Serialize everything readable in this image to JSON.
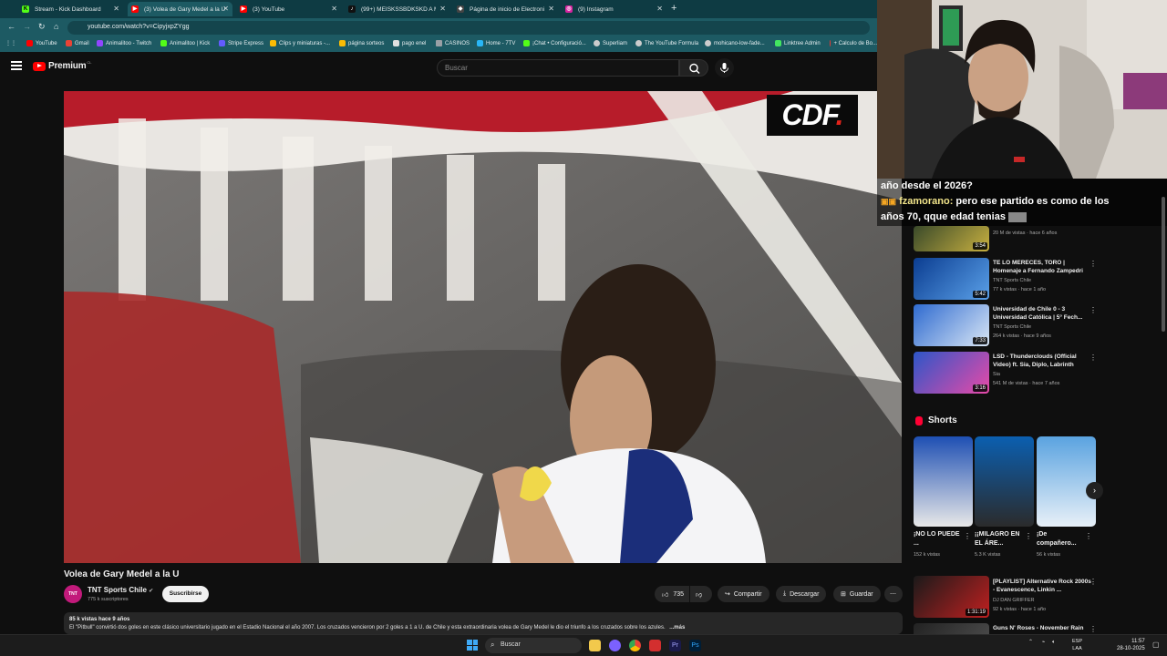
{
  "browser": {
    "tabs": [
      {
        "label": "Stream - Kick Dashboard",
        "icon": "kick-icon",
        "color": "#53fc18"
      },
      {
        "label": "(3) Volea de Gary Medel a la U",
        "icon": "youtube-icon",
        "color": "#ff0000"
      },
      {
        "label": "(3) YouTube",
        "icon": "youtube-icon",
        "color": "#ff0000"
      },
      {
        "label": "(99+) MEISKSSBDKSKD A MAMÁ",
        "icon": "tiktok-icon",
        "color": "#111111"
      },
      {
        "label": "Página de inicio de Electronic Arts",
        "icon": "ea-icon",
        "color": "#444444"
      },
      {
        "label": "(9) Instagram",
        "icon": "instagram-icon",
        "color": "#d6249f"
      }
    ],
    "new_tab": "+",
    "url": "youtube.com/watch?v=CipyjxpZYgg",
    "bookmarks": [
      {
        "label": "YouTube",
        "color": "#ff0000"
      },
      {
        "label": "Gmail",
        "color": "#ea4335"
      },
      {
        "label": "Animalitoo - Twitch",
        "color": "#9146ff"
      },
      {
        "label": "Animalitoo | Kick",
        "color": "#53fc18"
      },
      {
        "label": "Stripe Express",
        "color": "#635bff"
      },
      {
        "label": "Clips y miniaturas -...",
        "color": "#fbbc04"
      },
      {
        "label": "página sorteos",
        "color": "#fbbc04"
      },
      {
        "label": "pago enel",
        "color": "#e0e0e0"
      },
      {
        "label": "CASINOS",
        "color": "#9aa0a6"
      },
      {
        "label": "Home - 7TV",
        "color": "#29b6f6"
      },
      {
        "label": "¡Chat • Configuració...",
        "color": "#53fc18"
      },
      {
        "label": "Superliam",
        "color": "#cccccc"
      },
      {
        "label": "The YouTube Formula",
        "color": "#cccccc"
      },
      {
        "label": "mohicano-low-fade...",
        "color": "#cccccc"
      },
      {
        "label": "Linktree Admin",
        "color": "#43e660"
      },
      {
        "label": "+ Calculo de Bo...",
        "color": "#e53935"
      }
    ]
  },
  "youtube": {
    "logo_text": "Premium",
    "logo_region": "CL",
    "search_placeholder": "Buscar",
    "video": {
      "title": "Volea de Gary Medel a la U",
      "watermark": "CDF",
      "channel": "TNT Sports Chile",
      "channel_avatar": "TNT",
      "subscribers": "775 k suscriptores",
      "subscribe": "Suscribirse",
      "likes": "735",
      "share": "Compartir",
      "download": "Descargar",
      "save": "Guardar",
      "views_line": "85 k vistas  hace 9 años",
      "description": "El \"Pitbull\" convirtió dos goles en este clásico universitario jugado en el Estadio Nacional el año 2007. Los cruzados vencieron por 2 goles a 1 a U. de Chile y esta extraordinaria volea de Gary Medel le dio el triunfo a los cruzados sobre los azules.",
      "more": "...más"
    },
    "sidebar": [
      {
        "title": "",
        "channel": "",
        "meta": "20 M de vistas · hace 6 años",
        "duration": "3:54",
        "thumb": [
          "#3a4a2a",
          "#c8b040"
        ]
      },
      {
        "title": "TE LO MERECES, TORO | Homenaje a Fernando Zampedri",
        "channel": "TNT Sports Chile",
        "meta": "77 k vistas · hace 1 año",
        "duration": "5:42",
        "thumb": [
          "#0b3d91",
          "#5aa0e8"
        ]
      },
      {
        "title": "Universidad de Chile 0 - 3 Universidad Católica | 5° Fech...",
        "channel": "TNT Sports Chile",
        "meta": "264 k vistas · hace 9 años",
        "duration": "7:33",
        "thumb": [
          "#2f6bd0",
          "#d9e6f5"
        ]
      },
      {
        "title": "LSD - Thunderclouds (Official Video) ft. Sia, Diplo, Labrinth",
        "channel": "Sia",
        "meta": "541 M de vistas · hace 7 años",
        "duration": "3:16",
        "thumb": [
          "#2d56c8",
          "#e84aa8"
        ]
      },
      {
        "title": "[PLAYLIST] Alternative Rock 2000s - Evanescence, Linkin ...",
        "channel": "DJ DAN GRIFFER",
        "meta": "92 k vistas · hace 1 año",
        "duration": "1:31:19",
        "thumb": [
          "#1a1a1a",
          "#c02020"
        ]
      },
      {
        "title": "Guns N' Roses - November Rain",
        "channel": "",
        "meta": "",
        "duration": "",
        "thumb": [
          "#222222",
          "#555555"
        ]
      }
    ],
    "shorts": {
      "heading": "Shorts",
      "items": [
        {
          "title": "¡NO LO PUEDE ...",
          "views": "152 k vistas",
          "thumb": [
            "#1e4fb3",
            "#e8e8e8"
          ]
        },
        {
          "title": "¡¡MILAGRO EN EL ÁRE...",
          "views": "5.3 K vistas",
          "thumb": [
            "#0b5fb0",
            "#2b2b2b"
          ]
        },
        {
          "title": "¡De compañero...",
          "views": "56 k vistas",
          "thumb": [
            "#5aa3e0",
            "#e8f0f8"
          ]
        }
      ],
      "next": "›"
    }
  },
  "stream_overlay": {
    "chat": [
      {
        "user": "",
        "text": "año desde el 2026?"
      },
      {
        "user": "fzamorano:",
        "text": "pero ese partido es como de los"
      },
      {
        "user": "",
        "text": "años 70, qque edad tenias"
      }
    ]
  },
  "taskbar": {
    "search": "Buscar",
    "lang_top": "ESP",
    "lang_bottom": "LAA",
    "time": "11:57",
    "date": "28-10-2025"
  }
}
